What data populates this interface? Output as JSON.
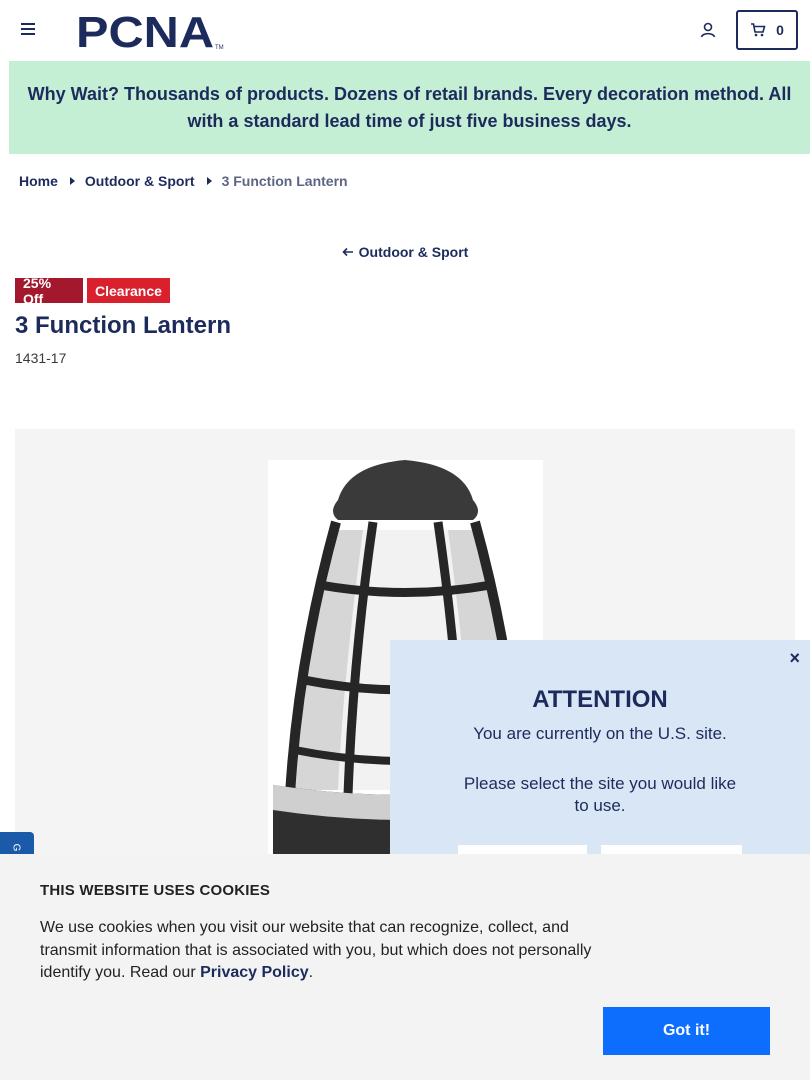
{
  "header": {
    "cart_count": "0"
  },
  "promo": {
    "text": "Why Wait? Thousands of products. Dozens of retail brands. Every decoration method. All with a standard lead time of just five business days."
  },
  "breadcrumb": {
    "home": "Home",
    "category": "Outdoor & Sport",
    "current": "3 Function Lantern"
  },
  "back_link": "Outdoor & Sport",
  "badges": {
    "discount": "25% Off",
    "clearance": "Clearance"
  },
  "product": {
    "title": "3 Function Lantern",
    "sku": "1431-17"
  },
  "modal": {
    "title": "ATTENTION",
    "current_site": "You are currently on the U.S. site.",
    "prompt": "Please select the site you would like to use.",
    "close": "×"
  },
  "cookie": {
    "title": "THIS WEBSITE USES COOKIES",
    "text": "We use cookies when you visit our website that can recognize, collect, and transmit information that is associated with you, but which does not personally identify you. Read our ",
    "link": "Privacy Policy",
    "end": ".",
    "button": "Got it!"
  },
  "colors": {
    "brand_navy": "#1d2b5c",
    "promo_bg": "#c4efd5",
    "badge_off": "#a3182c",
    "badge_clearance": "#d9212e",
    "cookie_button": "#0d6efd",
    "modal_bg": "#d8e6f6"
  }
}
